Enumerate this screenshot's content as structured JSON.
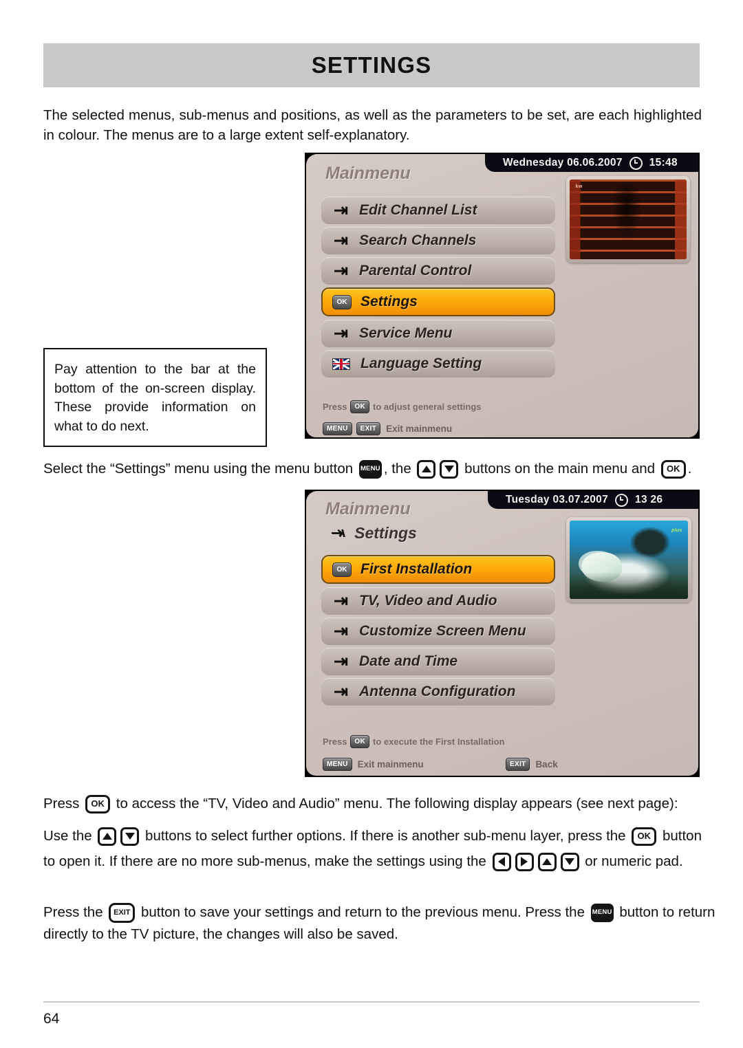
{
  "page": {
    "title": "SETTINGS",
    "number": "64"
  },
  "intro": {
    "text": "The selected menus, sub-menus and positions, as well as the parameters to be set, are each highlighted in colour. The menus are to a large extent self-explanatory."
  },
  "note_box": {
    "text": "Pay attention to the bar at the bottom of the on-screen display. These provide information on what to do next."
  },
  "instruction_select": {
    "part1": "Select the “Settings” menu using the menu button ",
    "btn1": "MENU",
    "part2": ", the ",
    "part3": " buttons on the main menu and ",
    "btn2": "OK",
    "part4": "."
  },
  "instruction_press_ok": {
    "part1": "Press ",
    "btn1": "OK",
    "part2": " to access the “TV, Video and Audio” menu. The following display appears (see next page):"
  },
  "instruction_use": {
    "part1": "Use the ",
    "part2": " buttons to select further options. If there is another sub-menu layer, press the ",
    "btn1": "OK",
    "part3": " button",
    "part4": "to open it. If there are no more sub-menus, make the settings using the ",
    "part5": " or numeric pad."
  },
  "instruction_exit": {
    "part1": "Press the ",
    "btn1": "EXIT",
    "part2": " button to save your settings and return to the previous menu. Press the ",
    "btn2": "MENU",
    "part3": " button to return",
    "part4": "directly to the TV picture, the changes will also be saved."
  },
  "screen1": {
    "title": "Mainmenu",
    "status_date": "Wednesday 06.06.2007",
    "status_time": "15:48",
    "items": [
      {
        "label": "Edit Channel List",
        "icon": "loop-arrow-icon",
        "selected": false
      },
      {
        "label": "Search Channels",
        "icon": "loop-arrow-icon",
        "selected": false
      },
      {
        "label": "Parental Control",
        "icon": "loop-arrow-icon",
        "selected": false
      },
      {
        "label": "Settings",
        "icon": "ok-badge-icon",
        "selected": true
      },
      {
        "label": "Service Menu",
        "icon": "loop-arrow-icon",
        "selected": false
      },
      {
        "label": "Language Setting",
        "icon": "uk-flag-icon",
        "selected": false
      }
    ],
    "hint_prefix": "Press",
    "hint_chip": "OK",
    "hint_suffix": "to adjust general settings",
    "footer_chip1": "MENU",
    "footer_chip2": "EXIT",
    "footer_label": "Exit mainmenu",
    "pip_logo": "kw"
  },
  "screen2": {
    "title": "Mainmenu",
    "breadcrumb": "Settings",
    "breadcrumb_icon": "loop-arrow-icon",
    "status_date": "Tuesday 03.07.2007",
    "status_time": "13 26",
    "items": [
      {
        "label": "First Installation",
        "icon": "ok-badge-icon",
        "selected": true
      },
      {
        "label": "TV, Video and Audio",
        "icon": "loop-arrow-icon",
        "selected": false
      },
      {
        "label": "Customize Screen Menu",
        "icon": "loop-arrow-icon",
        "selected": false
      },
      {
        "label": "Date and Time",
        "icon": "loop-arrow-icon",
        "selected": false
      },
      {
        "label": "Antenna Configuration",
        "icon": "loop-arrow-icon",
        "selected": false
      }
    ],
    "hint_prefix": "Press",
    "hint_chip": "OK",
    "hint_suffix": "to execute the First Installation",
    "footer_chip1": "MENU",
    "footer_label1": "Exit mainmenu",
    "footer_chip2": "EXIT",
    "footer_label2": "Back",
    "pip_logo": "plus"
  },
  "colors": {
    "header_band": "#c6c8ca",
    "selected_item": "#fdab09",
    "osd_panel": "#cfc2bd",
    "status_bar": "#0a0a14"
  }
}
